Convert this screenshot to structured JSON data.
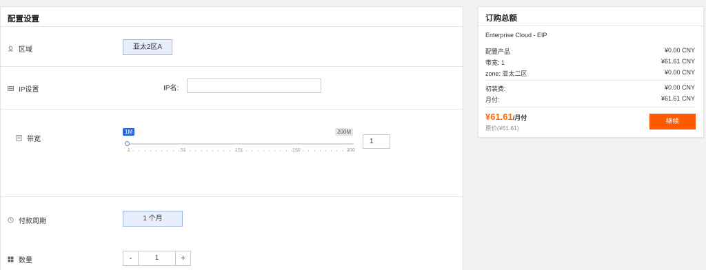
{
  "config": {
    "title": "配置设置",
    "region": {
      "label": "区域",
      "value": "亚太2区A"
    },
    "ip": {
      "label": "IP设置",
      "name_label": "IP名:",
      "name_value": ""
    },
    "bandwidth": {
      "label": "带宽",
      "min_badge": "1M",
      "max_badge": "200M",
      "ticks": [
        "1",
        "51",
        "101",
        "150",
        "200"
      ],
      "value": "1"
    },
    "period": {
      "label": "付款周期",
      "value": "1 个月"
    },
    "quantity": {
      "label": "数量",
      "minus": "-",
      "value": "1",
      "plus": "+"
    }
  },
  "summary": {
    "title": "订购总额",
    "product": "Enterprise Cloud - EIP",
    "lines": [
      {
        "label": "配置产品",
        "value": "¥0.00 CNY"
      },
      {
        "label": "带宽: 1",
        "value": "¥61.61 CNY"
      },
      {
        "label": "zone: 亚太二区",
        "value": "¥0.00 CNY"
      }
    ],
    "fees": [
      {
        "label": "初装费:",
        "value": "¥0.00 CNY"
      },
      {
        "label": "月付:",
        "value": "¥61.61 CNY"
      }
    ],
    "price": "¥61.61",
    "price_unit": "/月付",
    "original": "原价(¥61.61)",
    "continue_label": "继续",
    "accent": "#ff5a00"
  }
}
